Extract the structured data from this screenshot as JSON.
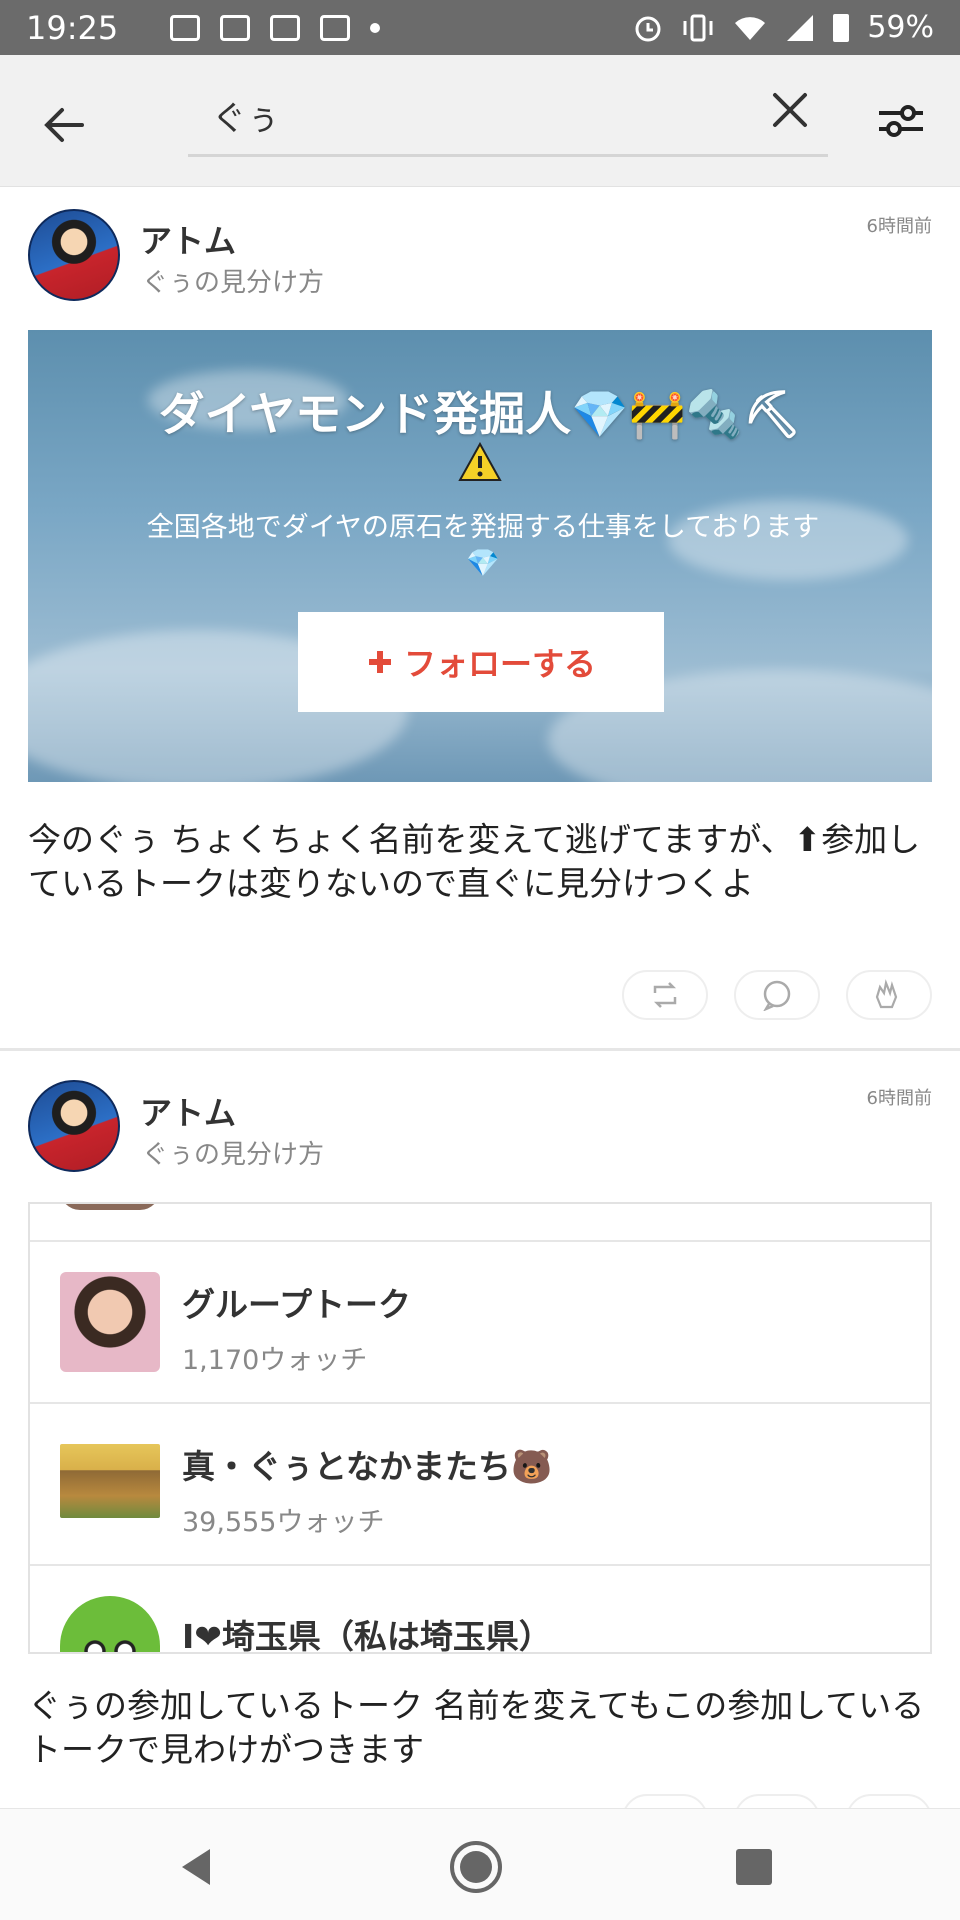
{
  "status_bar": {
    "time": "19:25",
    "battery": "59%"
  },
  "search": {
    "query": "ぐぅ",
    "back_icon": "arrow-left-icon",
    "clear_icon": "close-icon",
    "filter_icon": "filter-sliders-icon"
  },
  "posts": [
    {
      "author": "アトム",
      "talk": "ぐぅの見分け方",
      "time": "6時間前",
      "banner": {
        "title": "ダイヤモンド発掘人💎🚧🔩⛏",
        "description": "全国各地でダイヤの原石を発掘する仕事をしております💎",
        "follow_label": "フォローする"
      },
      "text": "今のぐぅ ちょくちょく名前を変えて逃げてますが、⬆参加しているトークは変りないので直ぐに見分けつくよ"
    },
    {
      "author": "アトム",
      "talk": "ぐぅの見分け方",
      "time": "6時間前",
      "talks": [
        {
          "name": "グループトーク",
          "watch": "1,170ウォッチ"
        },
        {
          "name": "真・ぐぅとなかまたち🐻",
          "watch": "39,555ウォッチ"
        },
        {
          "name": "I❤埼玉県（私は埼玉県）",
          "watch": ""
        }
      ],
      "text": "ぐぅの参加しているトーク 名前を変えてもこの参加しているトークで見わけがつきます"
    }
  ],
  "colors": {
    "accent": "#e34b3a",
    "status_bar": "#6b6b6b",
    "search_bg": "#f1f1f1"
  }
}
